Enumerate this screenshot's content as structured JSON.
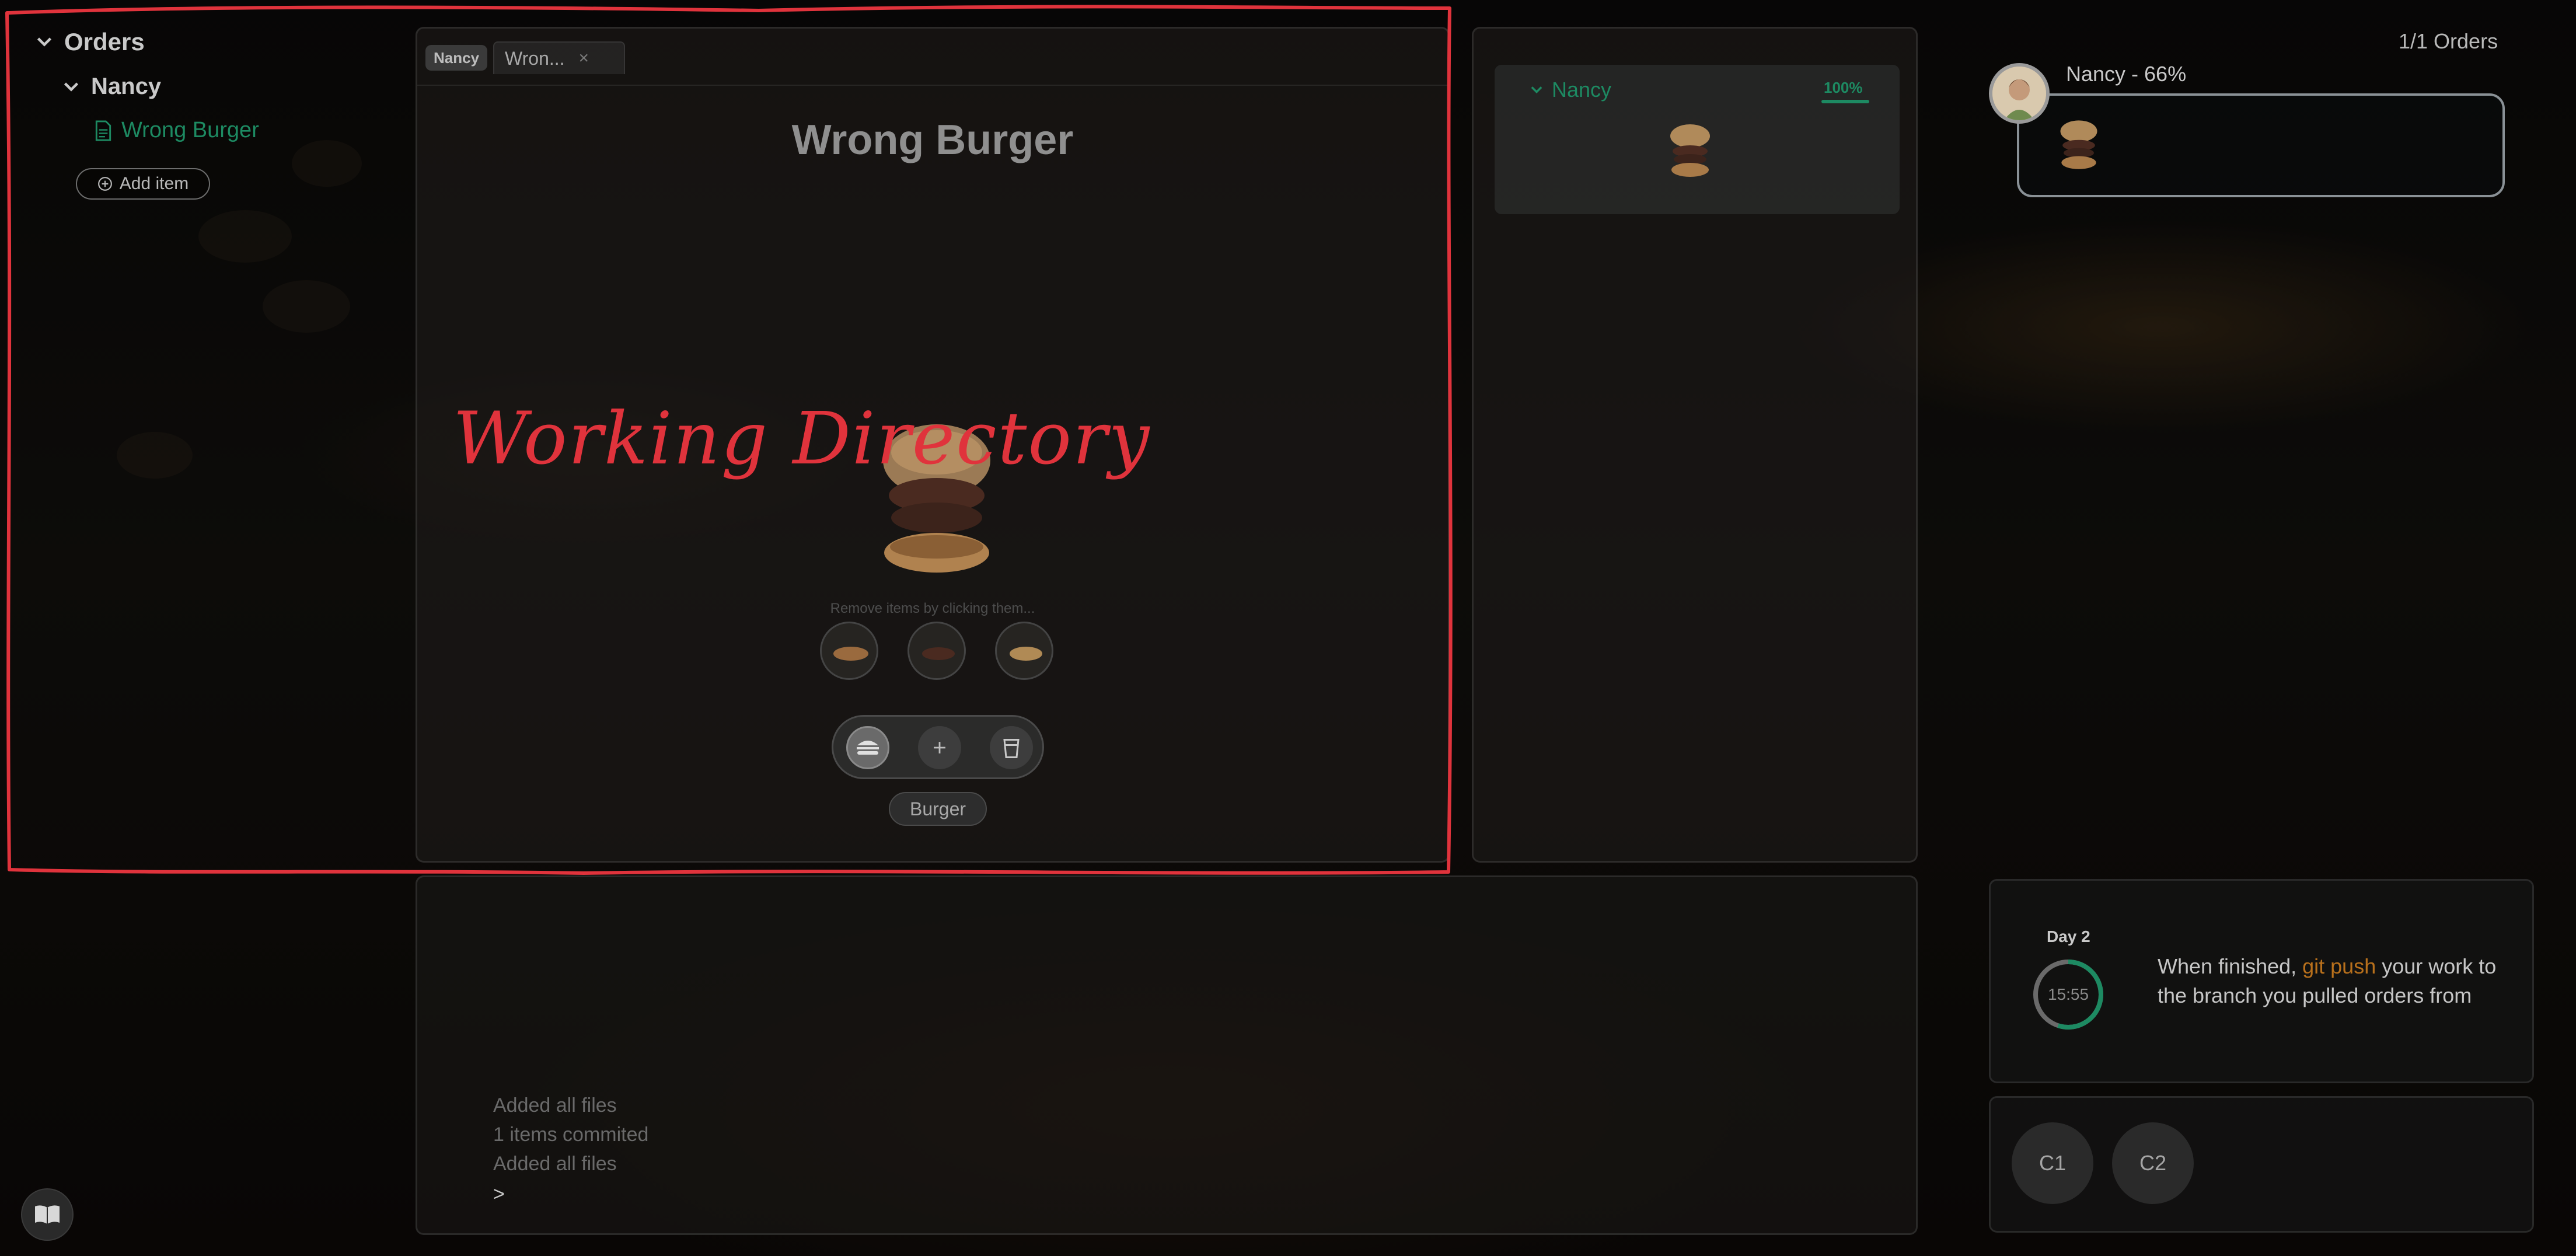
{
  "sidebar": {
    "root_label": "Orders",
    "customer_label": "Nancy",
    "file_label": "Wrong Burger",
    "add_item_label": "Add item",
    "book_icon": "book-icon"
  },
  "editor": {
    "tag_label": "Nancy",
    "tab_label": "Wron...",
    "tab_close": "×",
    "title": "Wrong Burger",
    "hint": "Remove items by clicking them...",
    "category_label": "Burger"
  },
  "staging": {
    "customer": "Nancy",
    "percent": "100%",
    "progress": 1.0
  },
  "terminal": {
    "lines": [
      "Added all files",
      "1 items commited",
      "Added all files"
    ],
    "prompt": ">"
  },
  "orders": {
    "count_label": "1/1 Orders",
    "current_label": "Nancy - 66%"
  },
  "day_card": {
    "day_label": "Day 2",
    "timer": "15:55",
    "timer_fraction": 0.55,
    "message_before": "When finished, ",
    "message_cmd": "git push",
    "message_after": " your work to the branch you pulled orders from"
  },
  "commits": [
    "C1",
    "C2"
  ],
  "annotation": {
    "label": "Working Directory"
  },
  "colors": {
    "accent_green": "#1d8a62",
    "accent_orange": "#b8701c",
    "annotation_red": "#e0333c"
  }
}
